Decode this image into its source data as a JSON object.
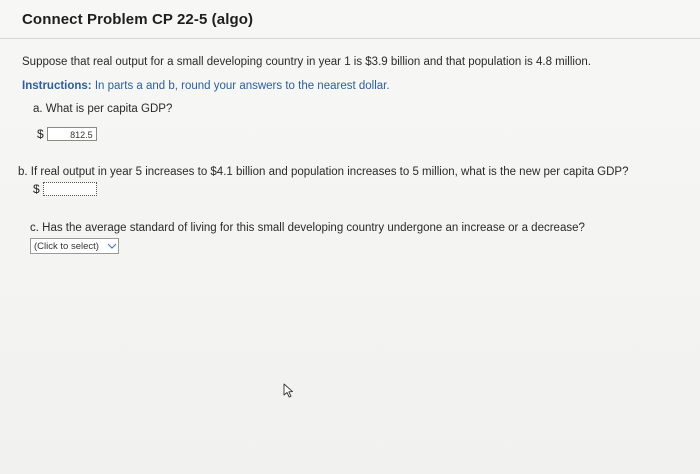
{
  "problem": {
    "title": "Connect Problem CP 22-5 (algo)",
    "intro": "Suppose that real output for a small developing country in year 1 is $3.9 billion and that population is 4.8 million.",
    "instructions_label": "Instructions:",
    "instructions_text": " In parts a and b, round your answers to the nearest dollar."
  },
  "part_a": {
    "question": "a. What is per capita GDP?",
    "currency": "$",
    "answer": "812.5"
  },
  "part_b": {
    "question": "b. If real output in year 5 increases to $4.1 billion and population increases to 5 million, what is the new per capita GDP?",
    "currency": "$",
    "answer": ""
  },
  "part_c": {
    "question": "c. Has the average standard of living for this small developing country undergone an increase or a decrease?",
    "select_value": "(Click to select)"
  },
  "icons": {
    "dropdown": "chevron-down-icon",
    "cursor": "mouse-pointer-icon"
  },
  "colors": {
    "instructions": "#2d5f9c",
    "dropdown_chevron": "#4a7fc0"
  }
}
